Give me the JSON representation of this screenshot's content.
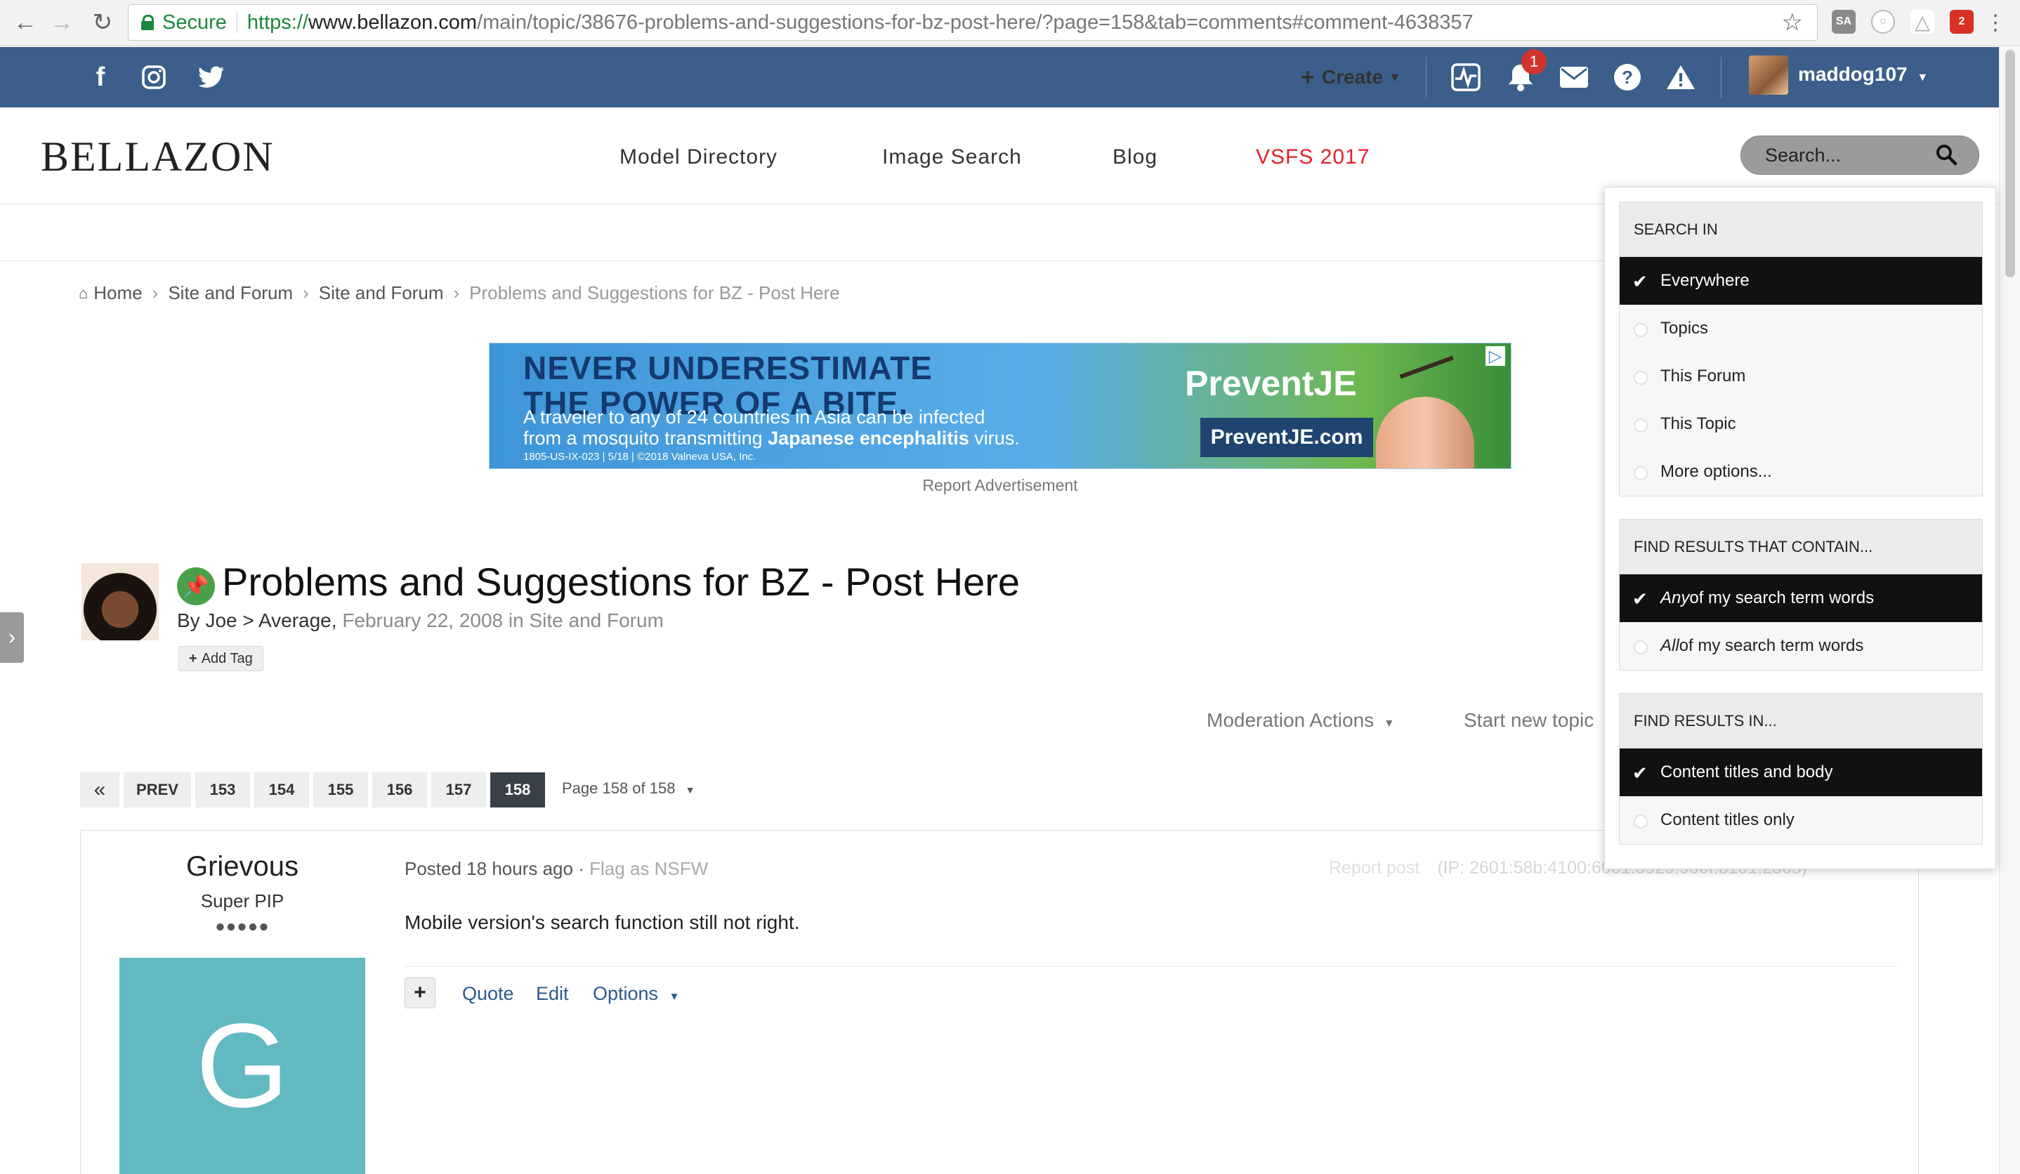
{
  "browser": {
    "secure_label": "Secure",
    "url_proto": "https://",
    "url_host": "www.bellazon.com",
    "url_path": "/main/topic/38676-problems-and-suggestions-for-bz-post-here/?page=158&tab=comments#comment-4638357",
    "icons": [
      "back-arrow-icon",
      "forward-arrow-icon",
      "reload-icon",
      "bookmark-star-icon"
    ],
    "extensions": [
      {
        "name": "sa-extension-icon",
        "label": "SA",
        "color": "#8a8a8a"
      },
      {
        "name": "circle-extension-icon",
        "label": "○",
        "color": "#b0b0b0"
      },
      {
        "name": "drive-extension-icon",
        "label": "△",
        "color": "#a8a8a8"
      },
      {
        "name": "calendar-extension-icon",
        "label": "2",
        "color": "#d93025"
      }
    ]
  },
  "topbar": {
    "bg_color": "#3b5f8a",
    "social_icons": [
      "facebook-icon",
      "instagram-icon",
      "twitter-icon"
    ],
    "create_label": "Create",
    "notification_count": "1",
    "username": "maddog107"
  },
  "header": {
    "logo": "BELLAZON",
    "nav": [
      "Model Directory",
      "Image Search",
      "Blog",
      "VSFS 2017"
    ],
    "search_placeholder": "Search..."
  },
  "breadcrumb": [
    "Home",
    "Site and Forum",
    "Site and Forum",
    "Problems and Suggestions for BZ - Post Here"
  ],
  "ad": {
    "headline_1": "NEVER UNDERESTIMATE",
    "headline_2": "THE POWER OF A BITE.",
    "body_1": "A traveler to any of 24 countries in Asia can be infected",
    "body_2_a": "from a mosquito transmitting ",
    "body_2_b": "Japanese encephalitis",
    "body_2_c": " virus.",
    "fine_print": "1805-US-IX-023 | 5/18 | ©2018 Valneva USA, Inc.",
    "brand": "PreventJE",
    "url": "PreventJE.com",
    "report": "Report Advertisement"
  },
  "topic": {
    "title": "Problems and Suggestions for BZ - Post Here",
    "by": "By Joe > Average, ",
    "date_forum": "February 22, 2008 in Site and Forum",
    "add_tag": "Add Tag",
    "moderation": "Moderation Actions",
    "start_new": "Start new topic"
  },
  "pager": {
    "first": "«",
    "prev": "PREV",
    "pages": [
      "153",
      "154",
      "155",
      "156",
      "157",
      "158"
    ],
    "active": "158",
    "page_of": "Page 158 of 158"
  },
  "post": {
    "author": "Grievous",
    "rank": "Super PIP",
    "pips": "●●●●●",
    "avatar_letter": "G",
    "avatar_color": "#62b9c2",
    "posted": "Posted 18 hours ago",
    "flag": "Flag as NSFW",
    "report": "Report post",
    "ip": "(IP: 2601:58b:4100:6061:3929:900f:b101:2365)",
    "body": "Mobile version's search function still not right.",
    "quote": "Quote",
    "edit": "Edit",
    "options": "Options"
  },
  "search_dropdown": {
    "sections": [
      {
        "heading": "SEARCH IN",
        "items": [
          {
            "label": "Everywhere",
            "selected": true
          },
          {
            "label": "Topics",
            "selected": false
          },
          {
            "label": "This Forum",
            "selected": false
          },
          {
            "label": "This Topic",
            "selected": false
          },
          {
            "label": "More options...",
            "selected": false
          }
        ]
      },
      {
        "heading": "FIND RESULTS THAT CONTAIN...",
        "items": [
          {
            "label_em": "Any",
            "label": " of my search term words",
            "selected": true
          },
          {
            "label_em": "All",
            "label": " of my search term words",
            "selected": false
          }
        ]
      },
      {
        "heading": "FIND RESULTS IN...",
        "items": [
          {
            "label": "Content titles and body",
            "selected": true
          },
          {
            "label": "Content titles only",
            "selected": false
          }
        ]
      }
    ]
  }
}
